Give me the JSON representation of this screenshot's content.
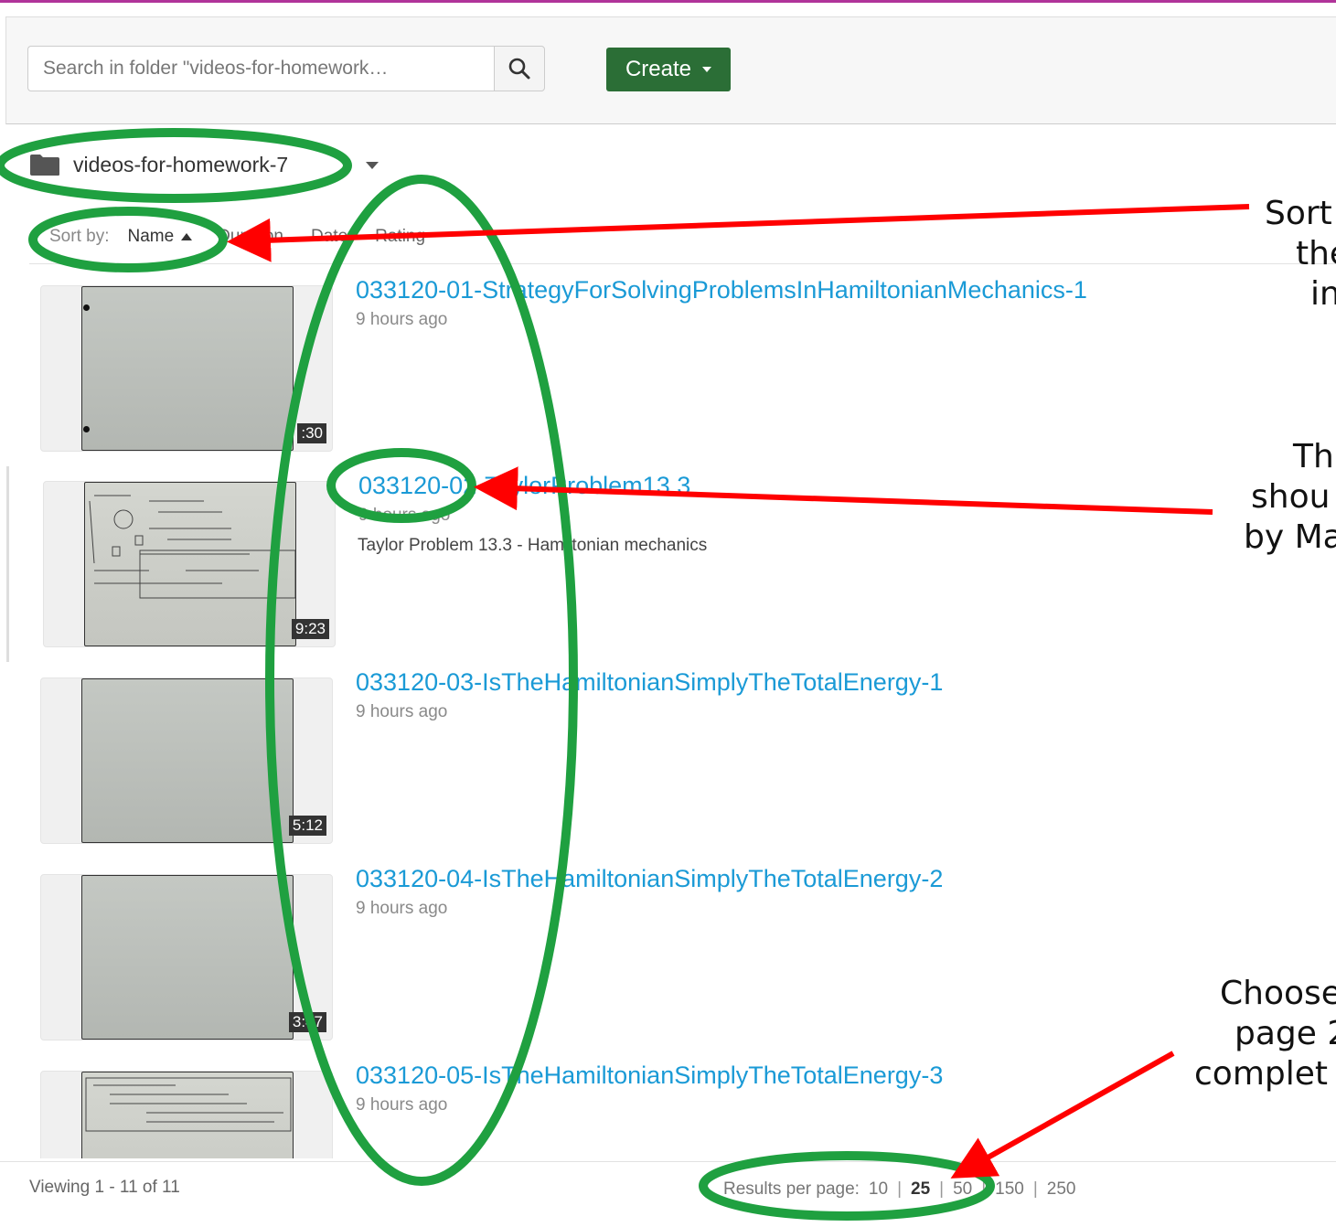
{
  "search": {
    "placeholder": "Search in folder \"videos-for-homework…"
  },
  "toolbar": {
    "create_label": "Create"
  },
  "folder": {
    "name": "videos-for-homework-7"
  },
  "sort": {
    "label": "Sort by:",
    "options": [
      "Name",
      "Duration",
      "Date",
      "Rating"
    ],
    "active": "Name"
  },
  "items": [
    {
      "title": "033120-01-StrategyForSolvingProblemsInHamiltonianMechanics-1",
      "time": "9 hours ago",
      "description": "",
      "duration": ":30"
    },
    {
      "title": "033120-02-TaylorProblem13.3",
      "time": "9 hours ago",
      "description": "Taylor Problem 13.3 - Hamiltonian mechanics",
      "duration": "9:23"
    },
    {
      "title": "033120-03-IsTheHamiltonianSimplyTheTotalEnergy-1",
      "time": "9 hours ago",
      "description": "",
      "duration": "5:12"
    },
    {
      "title": "033120-04-IsTheHamiltonianSimplyTheTotalEnergy-2",
      "time": "9 hours ago",
      "description": "",
      "duration": "3:47"
    },
    {
      "title": "033120-05-IsTheHamiltonianSimplyTheTotalEnergy-3",
      "time": "9 hours ago",
      "description": "",
      "duration": ""
    }
  ],
  "footer": {
    "viewing": "Viewing 1 - 11 of 11",
    "per_page_label": "Results per page:",
    "per_page_options": [
      "10",
      "25",
      "50",
      "150",
      "250"
    ],
    "per_page_selected": "25"
  },
  "annotations": {
    "sort_note": [
      "Sort",
      "the",
      "in"
    ],
    "order_note": [
      "Th",
      "shou",
      "by Ma"
    ],
    "page_note": [
      "Choose",
      "page 2",
      "complet"
    ]
  },
  "colors": {
    "create_button": "#2b6e36",
    "link": "#1a9ad6",
    "annotation_ellipse": "#1fa040",
    "annotation_arrow": "#ff0000",
    "top_border": "#b0349a"
  }
}
